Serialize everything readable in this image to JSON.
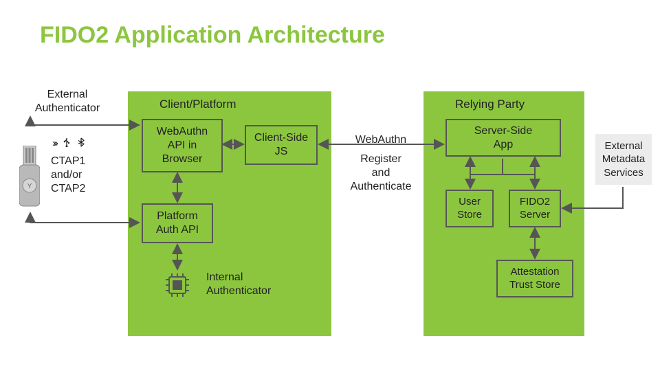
{
  "title": "FIDO2 Application Architecture",
  "externalAuth": {
    "label": "External\nAuthenticator",
    "protocol": "CTAP1\nand/or\nCTAP2"
  },
  "clientPanel": {
    "label": "Client/Platform",
    "webauthn": "WebAuthn\nAPI in\nBrowser",
    "clientjs": "Client-Side\nJS",
    "platformApi": "Platform\nAuth API",
    "internalAuth": "Internal\nAuthenticator"
  },
  "middle": {
    "l1": "WebAuthn",
    "l2": "Register\nand\nAuthenticate"
  },
  "rpPanel": {
    "label": "Relying Party",
    "serverApp": "Server-Side\nApp",
    "userStore": "User\nStore",
    "fidoServer": "FIDO2\nServer",
    "attStore": "Attestation\nTrust Store"
  },
  "extMeta": "External\nMetadata\nServices",
  "chart_data": {
    "type": "diagram",
    "title": "FIDO2 Application Architecture",
    "nodes": [
      {
        "id": "ext_auth",
        "label": "External Authenticator",
        "group": null
      },
      {
        "id": "webauthn_api",
        "label": "WebAuthn API in Browser",
        "group": "Client/Platform"
      },
      {
        "id": "client_js",
        "label": "Client-Side JS",
        "group": "Client/Platform"
      },
      {
        "id": "platform_api",
        "label": "Platform Auth API",
        "group": "Client/Platform"
      },
      {
        "id": "internal_auth",
        "label": "Internal Authenticator",
        "group": "Client/Platform"
      },
      {
        "id": "server_app",
        "label": "Server-Side App",
        "group": "Relying Party"
      },
      {
        "id": "user_store",
        "label": "User Store",
        "group": "Relying Party"
      },
      {
        "id": "fido_server",
        "label": "FIDO2 Server",
        "group": "Relying Party"
      },
      {
        "id": "att_store",
        "label": "Attestation Trust Store",
        "group": "Relying Party"
      },
      {
        "id": "ext_meta",
        "label": "External Metadata Services",
        "group": null
      }
    ],
    "edges": [
      {
        "from": "ext_auth",
        "to": "webauthn_api",
        "label": "CTAP1 and/or CTAP2",
        "dir": "both"
      },
      {
        "from": "ext_auth",
        "to": "platform_api",
        "label": "CTAP1 and/or CTAP2",
        "dir": "both"
      },
      {
        "from": "webauthn_api",
        "to": "client_js",
        "dir": "both"
      },
      {
        "from": "webauthn_api",
        "to": "platform_api",
        "dir": "both"
      },
      {
        "from": "platform_api",
        "to": "internal_auth",
        "dir": "both"
      },
      {
        "from": "client_js",
        "to": "server_app",
        "label": "WebAuthn Register and Authenticate",
        "dir": "both"
      },
      {
        "from": "server_app",
        "to": "user_store",
        "dir": "both"
      },
      {
        "from": "server_app",
        "to": "fido_server",
        "dir": "both"
      },
      {
        "from": "fido_server",
        "to": "att_store",
        "dir": "both"
      },
      {
        "from": "ext_meta",
        "to": "fido_server",
        "dir": "one"
      }
    ]
  }
}
